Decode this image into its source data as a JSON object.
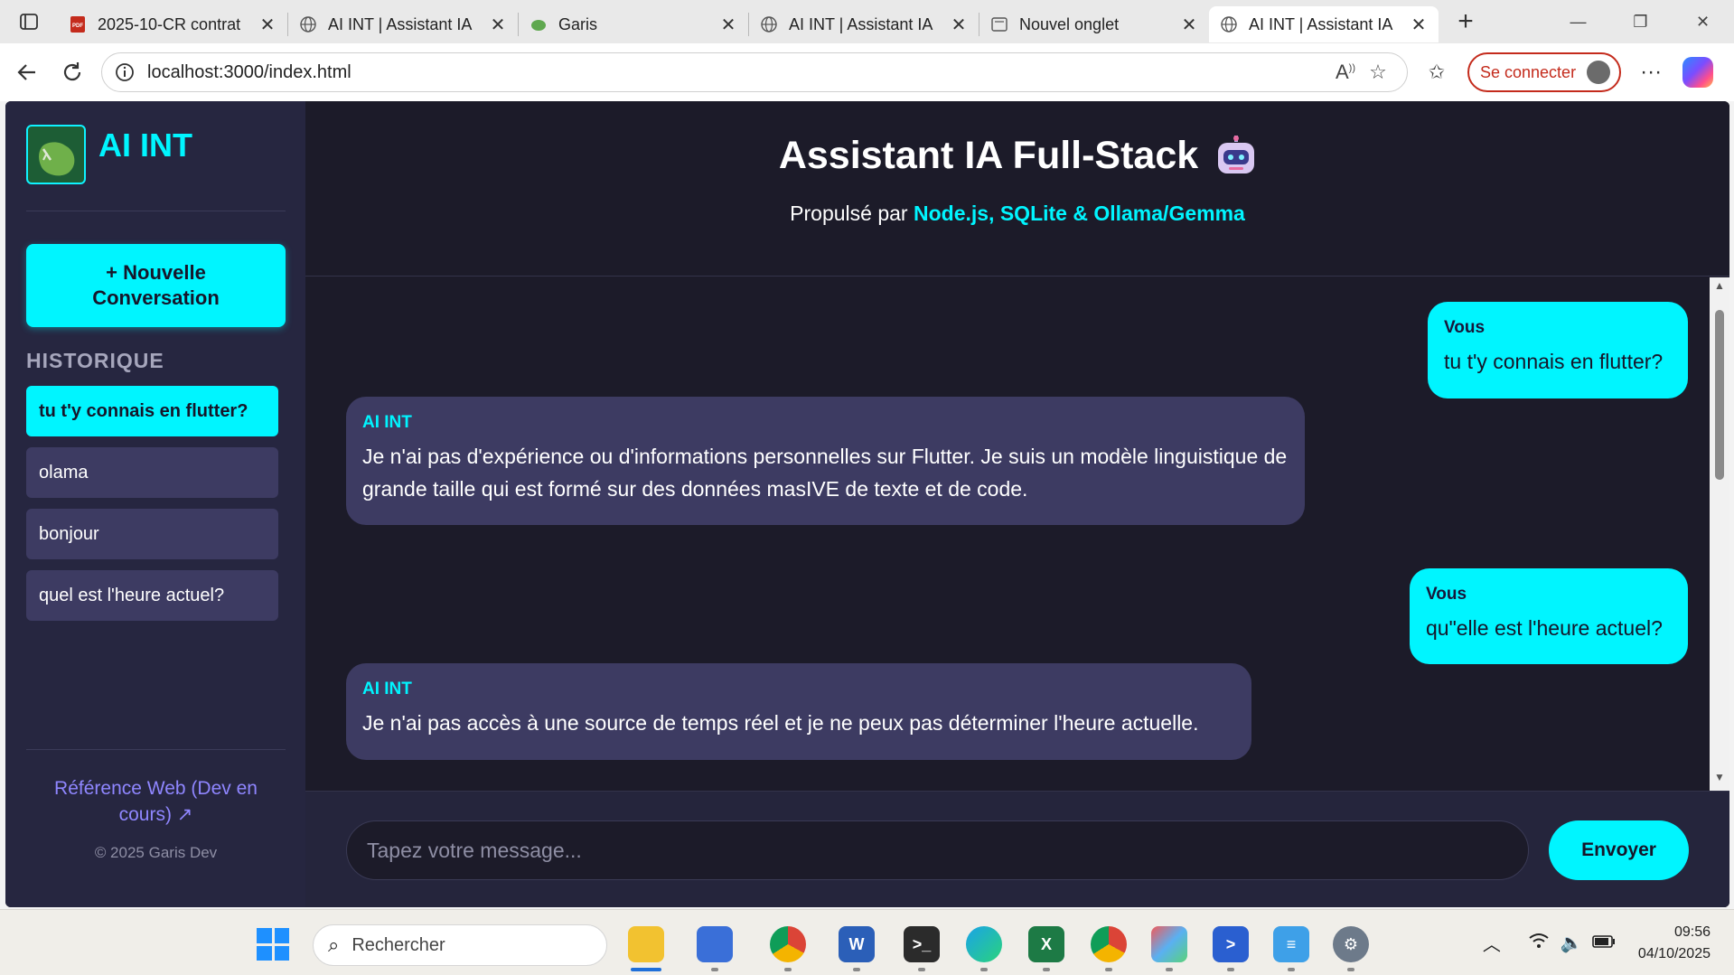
{
  "browser": {
    "tabs": [
      {
        "title": "2025-10-CR contrat",
        "icon": "pdf-icon",
        "active": false
      },
      {
        "title": "AI INT | Assistant IA",
        "icon": "globe-icon",
        "active": false
      },
      {
        "title": "Garis",
        "icon": "leaf-icon",
        "active": false
      },
      {
        "title": "AI INT | Assistant IA",
        "icon": "globe-icon",
        "active": false
      },
      {
        "title": "Nouvel onglet",
        "icon": "newtab-icon",
        "active": false
      },
      {
        "title": "AI INT | Assistant IA",
        "icon": "globe-icon",
        "active": true
      }
    ],
    "url": "localhost:3000/index.html",
    "signin_label": "Se connecter"
  },
  "sidebar": {
    "brand": "AI INT",
    "new_conversation": "+ Nouvelle Conversation",
    "history_title": "HISTORIQUE",
    "history": [
      {
        "label": "tu t'y connais en flutter?",
        "active": true
      },
      {
        "label": "olama",
        "active": false
      },
      {
        "label": "bonjour",
        "active": false
      },
      {
        "label": "quel est l'heure actuel?",
        "active": false
      }
    ],
    "reference_link": "Référence Web (Dev en cours) ↗",
    "copyright": "© 2025 Garis Dev"
  },
  "header": {
    "title": "Assistant IA Full-Stack",
    "subtitle_prefix": "Propulsé par ",
    "subtitle_highlight": "Node.js, SQLite & Ollama/Gemma"
  },
  "messages": [
    {
      "role": "user",
      "author": "Vous",
      "text": "tu t'y connais en flutter?"
    },
    {
      "role": "ai",
      "author": "AI INT",
      "text": "Je n'ai pas d'expérience ou d'informations personnelles sur Flutter. Je suis un modèle linguistique de grande taille qui est formé sur des données masIVE de texte et de code."
    },
    {
      "role": "user",
      "author": "Vous",
      "text": "qu\"elle est l'heure actuel?"
    },
    {
      "role": "ai",
      "author": "AI INT",
      "text": "Je n'ai pas accès à une source de temps réel et je ne peux pas déterminer l'heure actuelle."
    }
  ],
  "composer": {
    "placeholder": "Tapez votre message...",
    "send_label": "Envoyer"
  },
  "taskbar": {
    "search_label": "Rechercher",
    "time": "09:56",
    "date": "04/10/2025"
  },
  "colors": {
    "accent": "#00f5ff",
    "app_bg": "#1c1b29",
    "sidebar_bg": "#262640",
    "ai_bubble": "#3d3b62",
    "link": "#8f86ff"
  }
}
